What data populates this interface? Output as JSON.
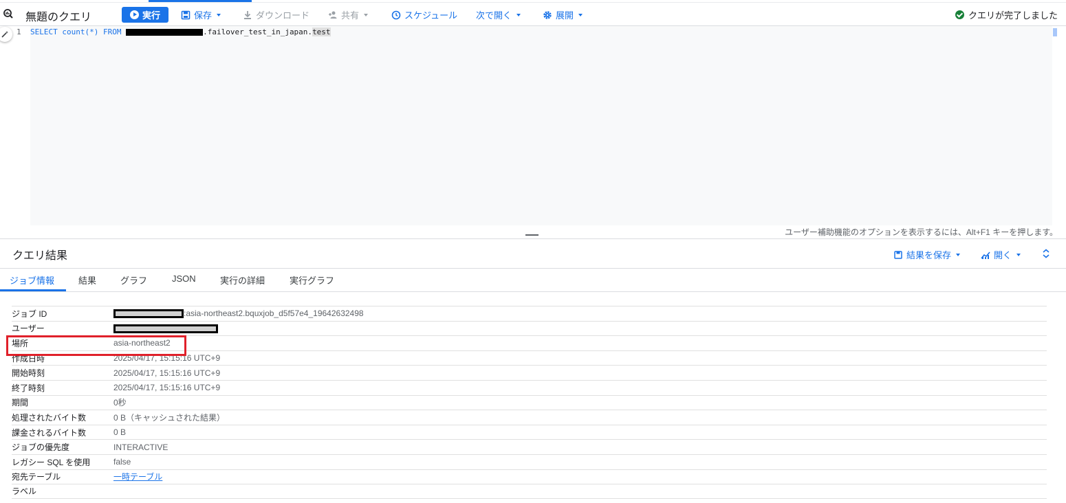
{
  "toolbar": {
    "title": "無題のクエリ",
    "run_label": "実行",
    "save_label": "保存",
    "download_label": "ダウンロード",
    "share_label": "共有",
    "schedule_label": "スケジュール",
    "open_next_label": "次で開く",
    "deploy_label": "展開",
    "status_text": "クエリが完了しました"
  },
  "editor": {
    "line_number": "1",
    "code_keyword_1": "SELECT",
    "code_mid": " count(*) ",
    "code_keyword_2": "FROM",
    "code_after_redaction": ".failover_test_in_japan.",
    "code_selected": "test",
    "a11y_hint": "ユーザー補助機能のオプションを表示するには、Alt+F1 キーを押します。"
  },
  "results": {
    "title": "クエリ結果",
    "save_results_label": "結果を保存",
    "open_label": "開く"
  },
  "tabs": [
    {
      "label": "ジョブ情報",
      "active": true
    },
    {
      "label": "結果",
      "active": false
    },
    {
      "label": "グラフ",
      "active": false
    },
    {
      "label": "JSON",
      "active": false
    },
    {
      "label": "実行の詳細",
      "active": false
    },
    {
      "label": "実行グラフ",
      "active": false
    }
  ],
  "job_info": {
    "job_id_key": "ジョブ ID",
    "job_id_value": ":asia-northeast2.bquxjob_d5f57e4_19642632498",
    "user_key": "ユーザー",
    "location_key": "場所",
    "location_value": "asia-northeast2",
    "created_key": "作成日時",
    "created_value": "2025/04/17, 15:15:16 UTC+9",
    "start_key": "開始時刻",
    "start_value": "2025/04/17, 15:15:16 UTC+9",
    "end_key": "終了時刻",
    "end_value": "2025/04/17, 15:15:16 UTC+9",
    "duration_key": "期間",
    "duration_value": "0秒",
    "bytes_processed_key": "処理されたバイト数",
    "bytes_processed_value": "0 B（キャッシュされた結果）",
    "bytes_billed_key": "課金されるバイト数",
    "bytes_billed_value": "0 B",
    "priority_key": "ジョブの優先度",
    "priority_value": "INTERACTIVE",
    "legacy_sql_key": "レガシー SQL を使用",
    "legacy_sql_value": "false",
    "destination_key": "宛先テーブル",
    "destination_value": "一時テーブル",
    "labels_key": "ラベル"
  },
  "colors": {
    "accent": "#1a73e8",
    "success": "#188038",
    "highlight_box": "#e0202a"
  },
  "icons": [
    "query-icon",
    "play-icon",
    "save-icon",
    "download-icon",
    "share-icon",
    "schedule-icon",
    "gear-icon",
    "check-circle-icon",
    "magic-wand-icon",
    "chart-icon",
    "expand-icon"
  ]
}
